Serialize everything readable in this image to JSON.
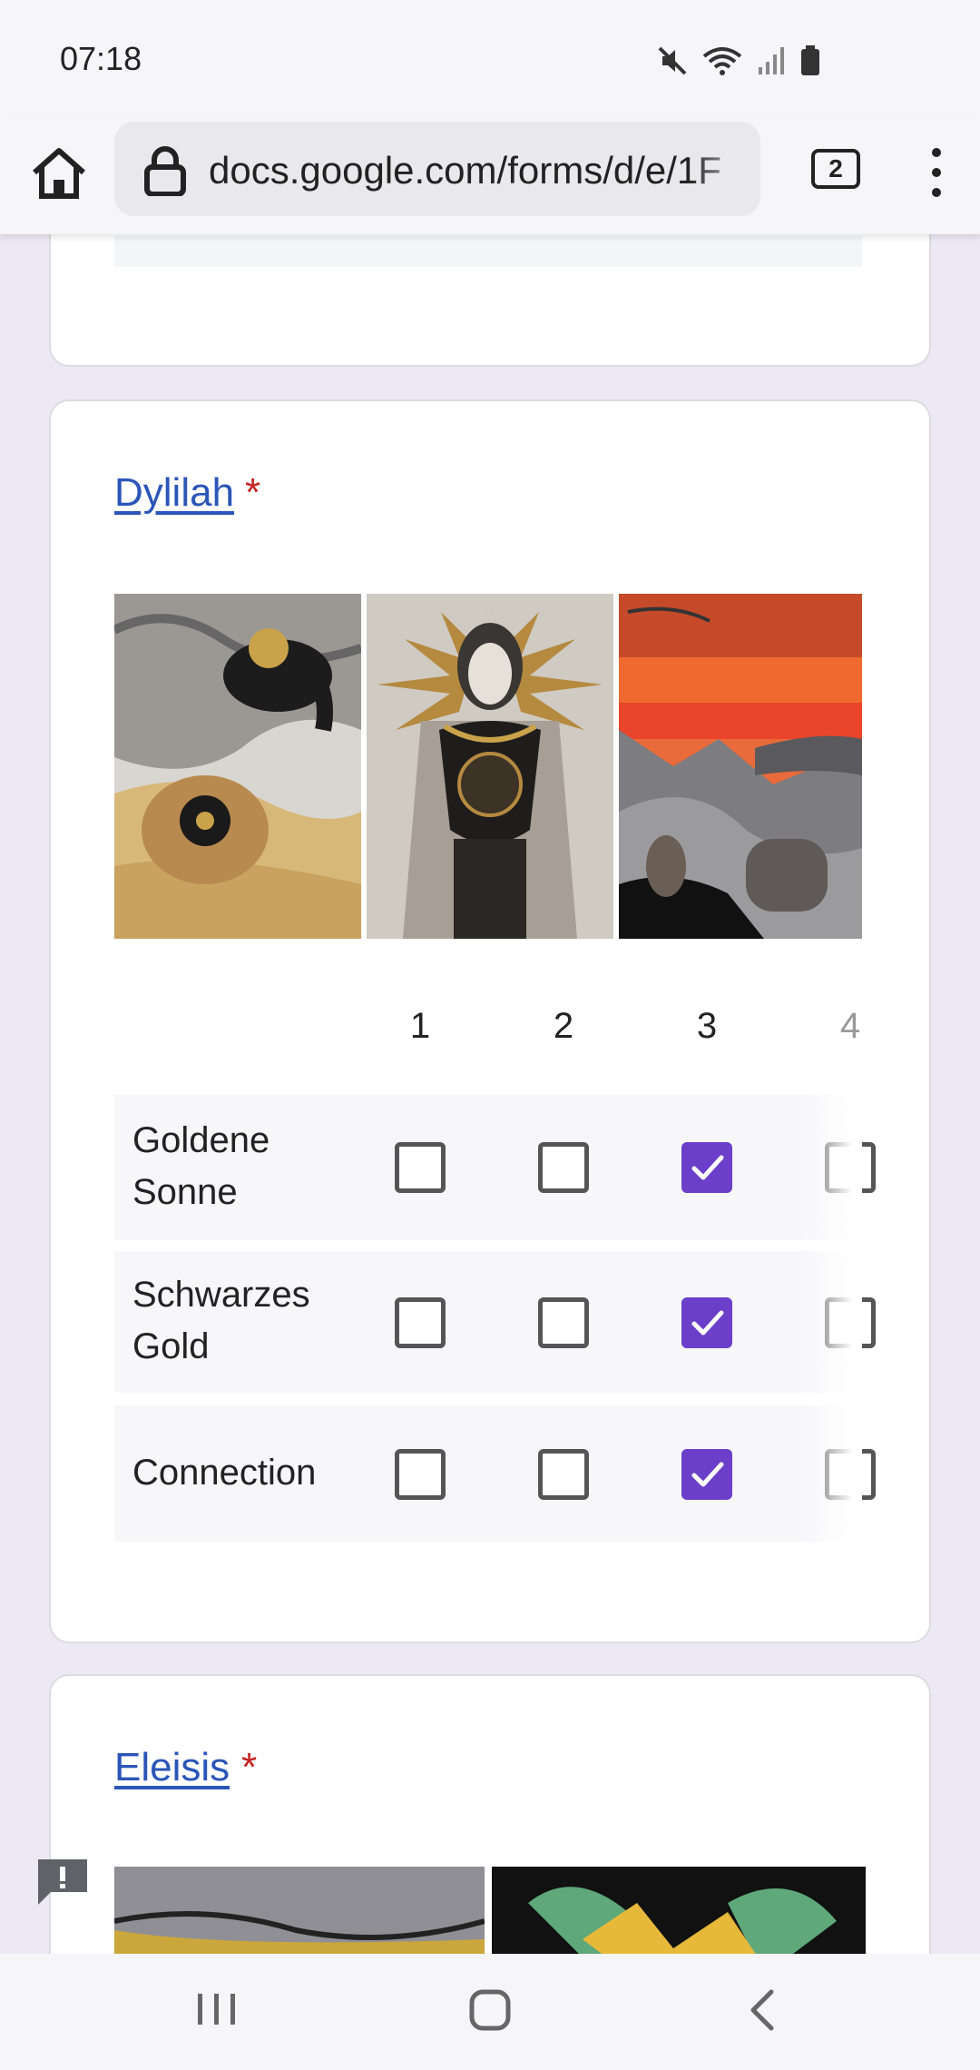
{
  "status_bar": {
    "time": "07:18"
  },
  "browser": {
    "url": "docs.google.com/forms/d/e/1F",
    "tab_count": "2"
  },
  "questions": [
    {
      "title": "Dylilah",
      "required_marker": "*",
      "columns": [
        "1",
        "2",
        "3",
        "4"
      ],
      "rows": [
        {
          "label": "Goldene Sonne",
          "selected_column": "3"
        },
        {
          "label": "Schwarzes Gold",
          "selected_column": "3"
        },
        {
          "label": "Connection",
          "selected_column": "3"
        }
      ]
    },
    {
      "title": "Eleisis",
      "required_marker": "*"
    }
  ],
  "colors": {
    "accent": "#6b3fc9",
    "link": "#2b55b8",
    "required": "#c5221f",
    "page_background": "#ece9f5"
  },
  "icons": [
    "home-icon",
    "lock-icon",
    "tabs-icon",
    "more-vert-icon",
    "mute-icon",
    "wifi-icon",
    "signal-icon",
    "battery-icon",
    "feedback-icon",
    "recent-apps-icon",
    "home-nav-icon",
    "back-icon"
  ]
}
